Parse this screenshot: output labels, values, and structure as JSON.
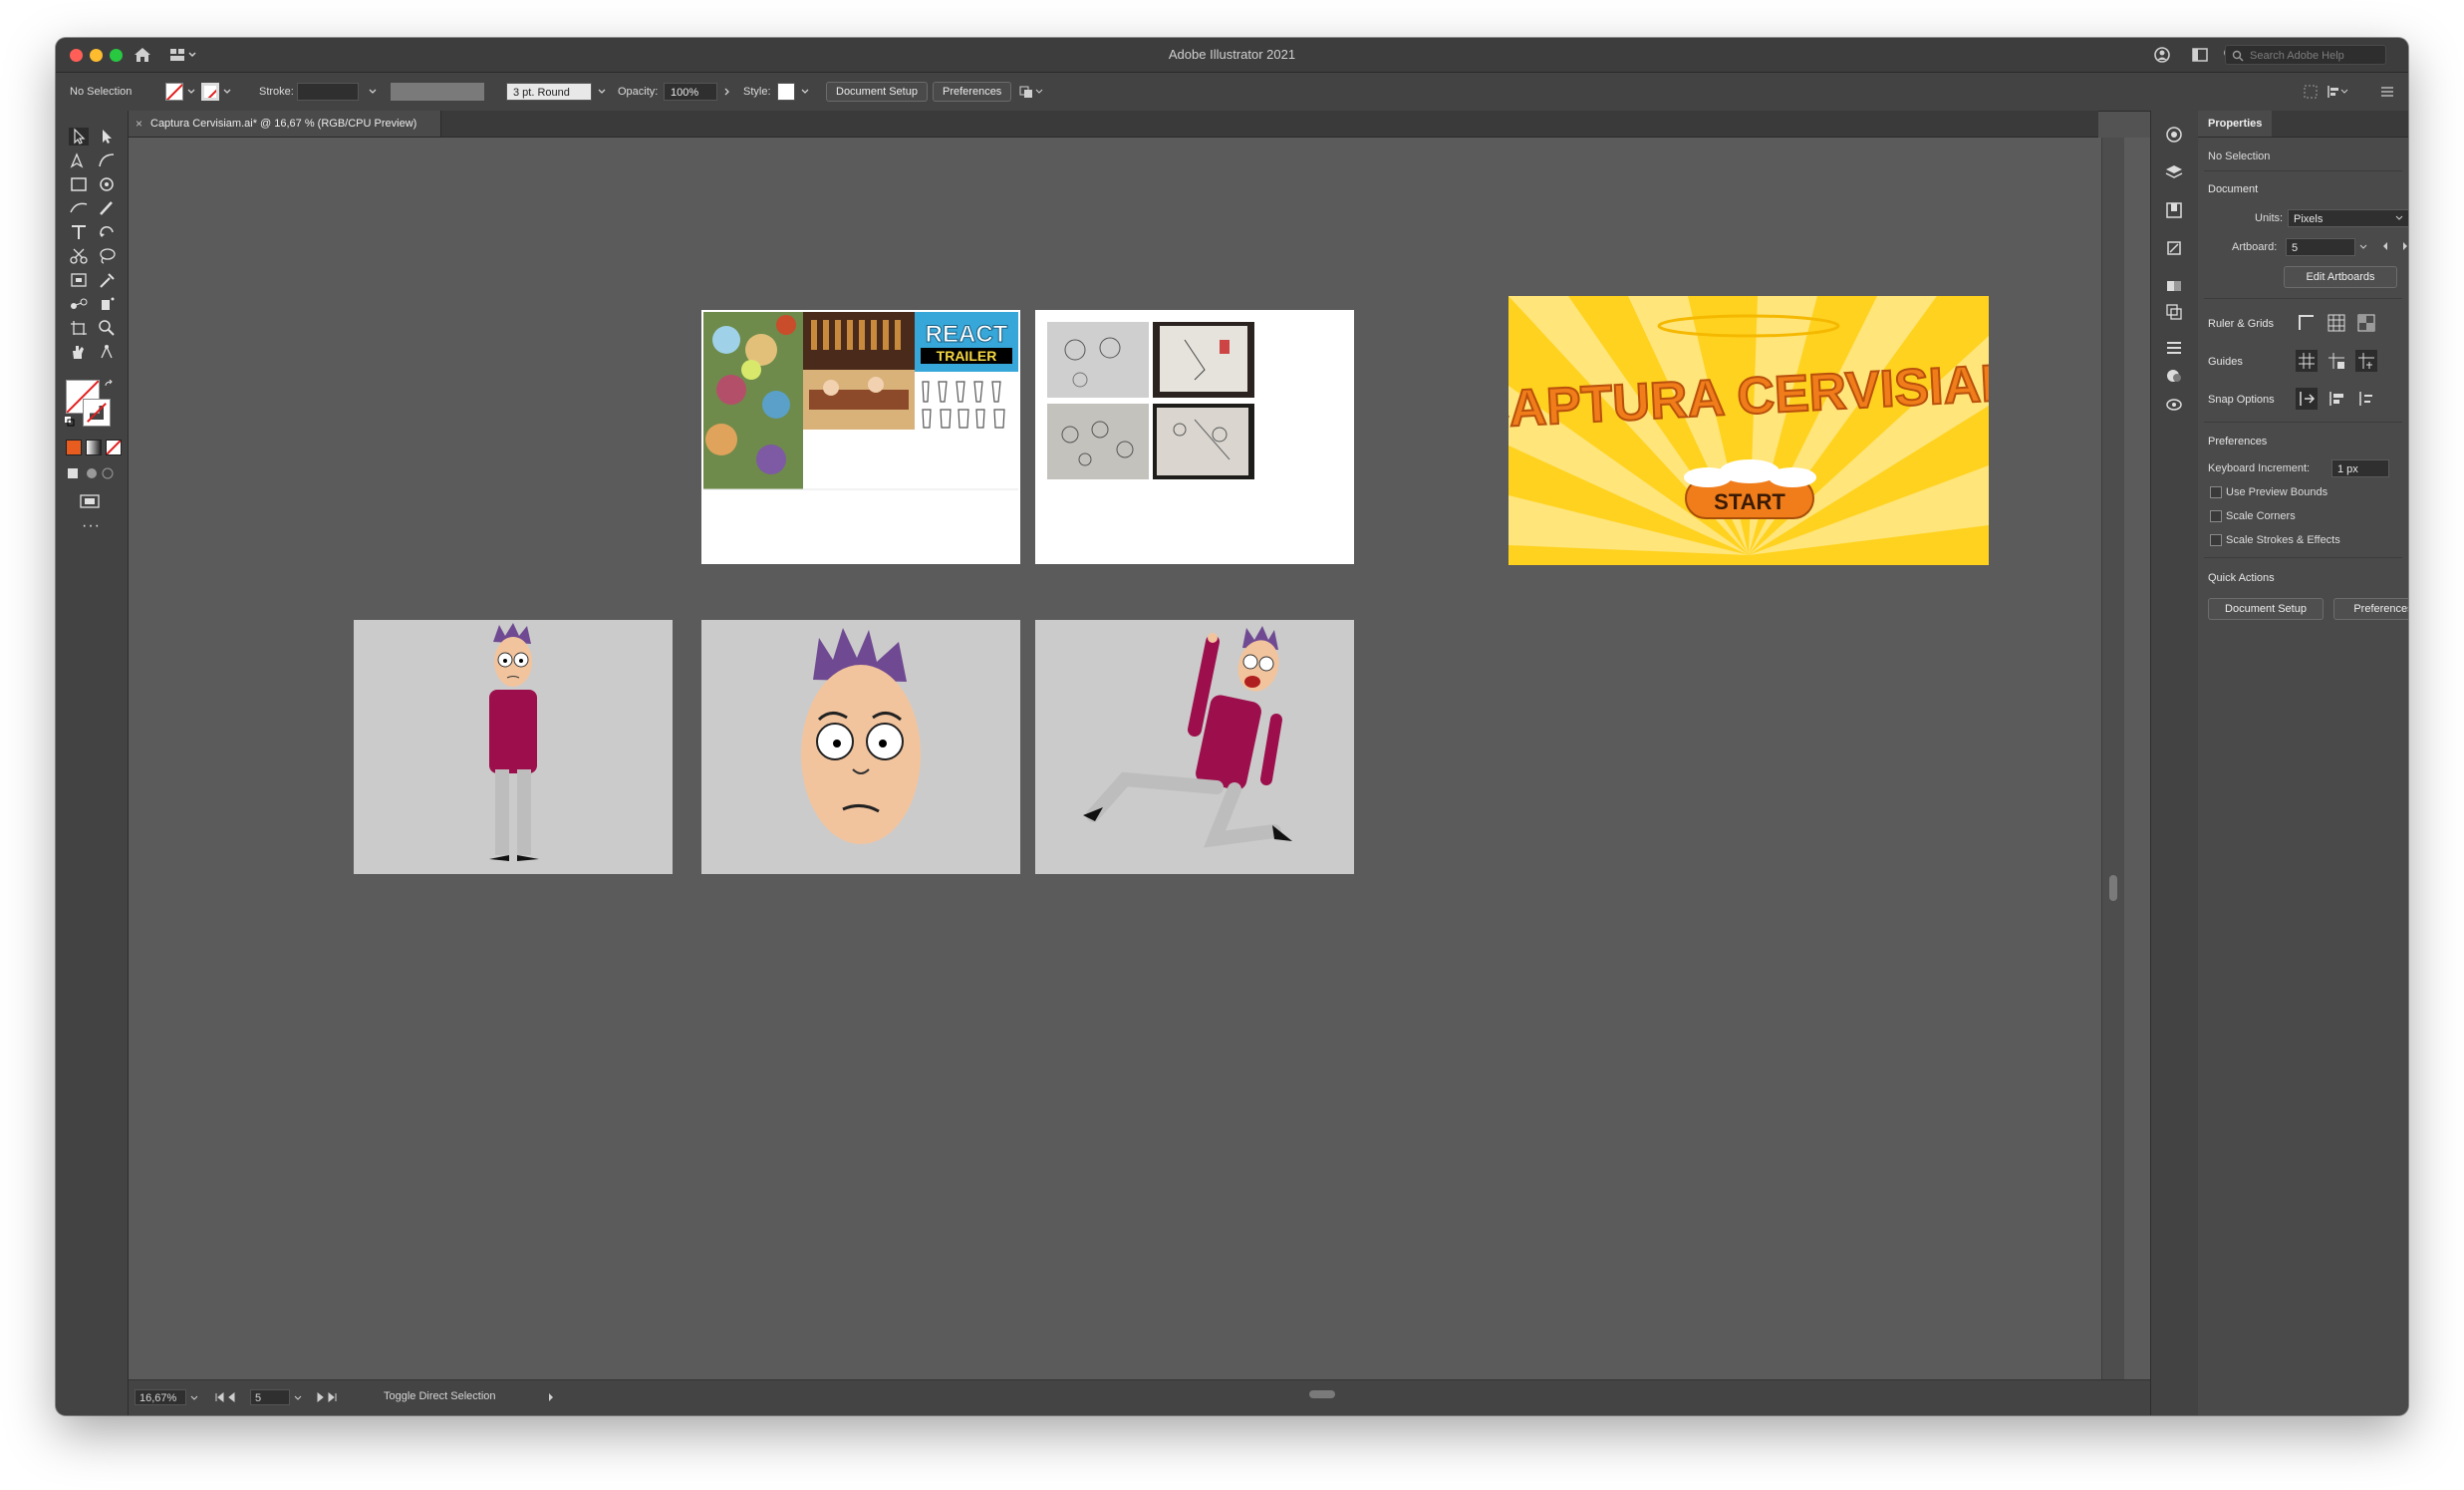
{
  "app": {
    "title": "Adobe Illustrator 2021",
    "search_placeholder": "Search Adobe Help"
  },
  "control_bar": {
    "selection": "No Selection",
    "stroke_label": "Stroke:",
    "brush_value": "3 pt. Round",
    "opacity_label": "Opacity:",
    "opacity_value": "100%",
    "style_label": "Style:",
    "document_setup": "Document Setup",
    "preferences": "Preferences"
  },
  "document_tab": {
    "title": "Captura Cervisiam.ai* @ 16,67 % (RGB/CPU Preview)",
    "close": "×"
  },
  "status_bar": {
    "zoom": "16,67%",
    "artboard": "5",
    "tool_hint": "Toggle Direct Selection"
  },
  "properties": {
    "tab": "Properties",
    "selection": "No Selection",
    "document_header": "Document",
    "units_label": "Units:",
    "units_value": "Pixels",
    "artboard_label": "Artboard:",
    "artboard_value": "5",
    "edit_artboards": "Edit Artboards",
    "ruler_grids": "Ruler & Grids",
    "guides": "Guides",
    "snap_options": "Snap Options",
    "preferences_header": "Preferences",
    "keyboard_increment_label": "Keyboard Increment:",
    "keyboard_increment_value": "1 px",
    "use_preview_bounds": "Use Preview Bounds",
    "scale_corners": "Scale Corners",
    "scale_strokes": "Scale Strokes & Effects",
    "quick_actions": "Quick Actions",
    "qa_document_setup": "Document Setup",
    "qa_preferences": "Preferences"
  },
  "artwork": {
    "poster_title_a": "REACT",
    "poster_title_b": "TRAILER",
    "game_title": "CAPTURA CERVISIAM",
    "start_label": "START"
  },
  "colors": {
    "canvas": "#5b5b5b",
    "panel": "#4a4a4a",
    "game_yellow": "#ffd21f",
    "game_orange": "#f07d1a",
    "shirt": "#9c0f4c",
    "hair": "#6f4a92"
  }
}
